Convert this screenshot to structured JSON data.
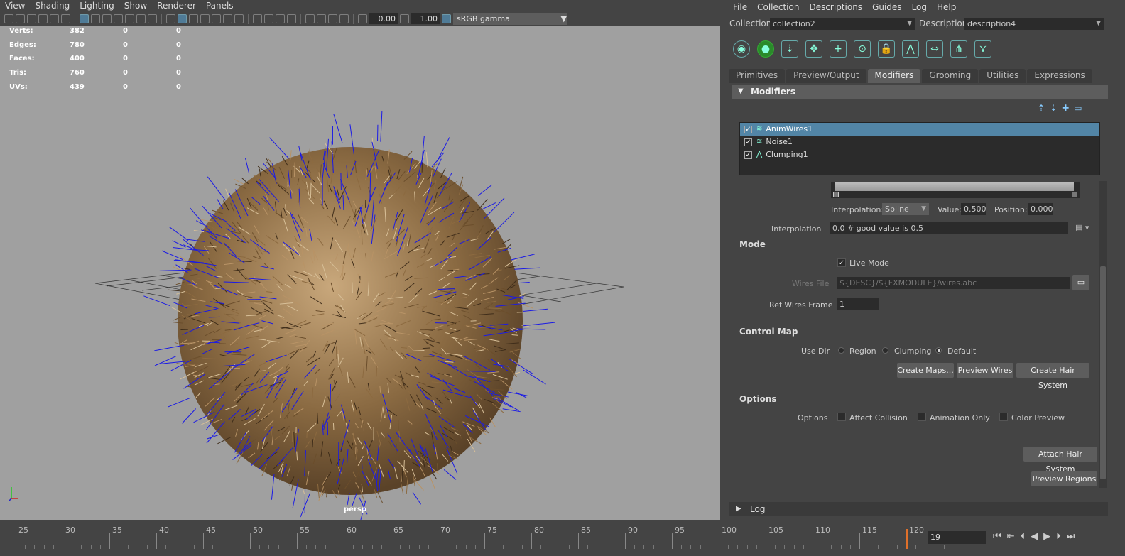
{
  "viewport": {
    "menu": [
      "View",
      "Shading",
      "Lighting",
      "Show",
      "Renderer",
      "Panels"
    ],
    "exposure": "0.00",
    "gamma": "1.00",
    "color_space": "sRGB gamma",
    "hud": [
      {
        "label": "Verts:",
        "v1": "382",
        "v2": "0",
        "v3": "0"
      },
      {
        "label": "Edges:",
        "v1": "780",
        "v2": "0",
        "v3": "0"
      },
      {
        "label": "Faces:",
        "v1": "400",
        "v2": "0",
        "v3": "0"
      },
      {
        "label": "Tris:",
        "v1": "760",
        "v2": "0",
        "v3": "0"
      },
      {
        "label": "UVs:",
        "v1": "439",
        "v2": "0",
        "v3": "0"
      }
    ],
    "camera_label": "persp"
  },
  "xgen": {
    "menu": [
      "File",
      "Collection",
      "Descriptions",
      "Guides",
      "Log",
      "Help"
    ],
    "collection_label": "Collection",
    "collection_value": "collection2",
    "description_label": "Description",
    "description_value": "description4",
    "tabs": [
      "Primitives",
      "Preview/Output",
      "Modifiers",
      "Grooming",
      "Utilities",
      "Expressions"
    ],
    "active_tab": "Modifiers",
    "modifiers_header": "Modifiers",
    "modifiers": [
      {
        "name": "AnimWires1",
        "checked": true,
        "selected": true
      },
      {
        "name": "Noise1",
        "checked": true,
        "selected": false
      },
      {
        "name": "Clumping1",
        "checked": true,
        "selected": false
      }
    ],
    "ramp": {
      "interp_label": "Interpolation:",
      "interp_value": "Spline",
      "value_label": "Value:",
      "value": "0.500",
      "position_label": "Position:",
      "position": "0.000"
    },
    "interpolation_label": "Interpolation",
    "interpolation_expr": "0.0 # good value is 0.5",
    "mode_section": "Mode",
    "live_mode_label": "Live Mode",
    "wires_file_label": "Wires File",
    "wires_file_value": "${DESC}/${FXMODULE}/wires.abc",
    "ref_frame_label": "Ref Wires Frame",
    "ref_frame_value": "1",
    "control_map_section": "Control Map",
    "use_dir_label": "Use Dir",
    "use_dir_options": [
      "Region",
      "Clumping",
      "Default"
    ],
    "use_dir_selected": "Default",
    "buttons": {
      "create_maps": "Create Maps...",
      "preview_wires": "Preview Wires",
      "create_hair": "Create Hair System",
      "attach_hair": "Attach Hair System",
      "preview_regions": "Preview Regions"
    },
    "options_section": "Options",
    "options_label": "Options",
    "options": [
      "Affect Collision",
      "Animation Only",
      "Color Preview"
    ],
    "log_header": "Log"
  },
  "timeline": {
    "labels": [
      "25",
      "30",
      "35",
      "40",
      "45",
      "50",
      "55",
      "60",
      "65",
      "70",
      "75",
      "80",
      "85",
      "90",
      "95",
      "100",
      "105",
      "110",
      "115",
      "120"
    ],
    "current_frame": "19"
  },
  "colors": {
    "selection": "#5285a6",
    "viewport_bg": "#a0a0a0",
    "guide_wires": "#1a1ae6",
    "hair": "#9c7a4e"
  }
}
